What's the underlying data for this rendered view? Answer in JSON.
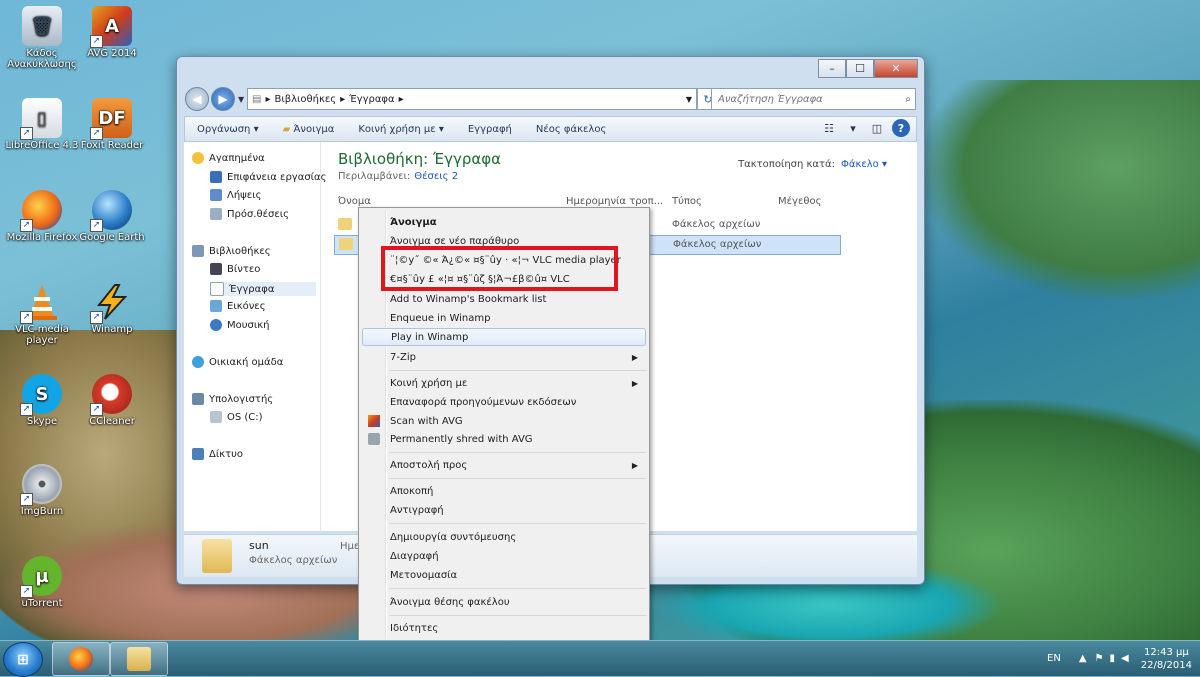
{
  "desktop": {
    "icons": [
      {
        "label": "Κάδος Ανακύκλωσης"
      },
      {
        "label": "AVG 2014"
      },
      {
        "label": "LibreOffice 4.3"
      },
      {
        "label": "Foxit Reader"
      },
      {
        "label": "Mozilla Firefox"
      },
      {
        "label": "Google Earth"
      },
      {
        "label": "VLC media player"
      },
      {
        "label": "Winamp"
      },
      {
        "label": "Skype"
      },
      {
        "label": "CCleaner"
      },
      {
        "label": "ImgBurn"
      },
      {
        "label": "uTorrent"
      }
    ]
  },
  "window": {
    "address": {
      "segments": [
        "Βιβλιοθήκες",
        "Έγγραφα"
      ]
    },
    "search": {
      "placeholder": "Αναζήτηση Έγγραφα"
    },
    "toolbar": {
      "organize": "Οργάνωση",
      "open": "Άνοιγμα",
      "share": "Κοινή χρήση με",
      "burn": "Εγγραφή",
      "new_folder": "Νέος φάκελος"
    },
    "nav": {
      "favorites": "Αγαπημένα",
      "desktop": "Επιφάνεια εργασίας",
      "downloads": "Λήψεις",
      "recent": "Πρόσ.θέσεις",
      "libraries": "Βιβλιοθήκες",
      "videos": "Βίντεο",
      "documents": "Έγγραφα",
      "pictures": "Εικόνες",
      "music": "Μουσική",
      "homegroup": "Οικιακή ομάδα",
      "computer": "Υπολογιστής",
      "os_drive": "OS (C:)",
      "network": "Δίκτυο"
    },
    "library": {
      "title": "Βιβλιοθήκη: Έγγραφα",
      "includes_label": "Περιλαμβάνει:",
      "locations": "Θέσεις 2",
      "arrange_label": "Τακτοποίηση κατά:",
      "arrange_value": "Φάκελο"
    },
    "columns": {
      "name": "Όνομα",
      "date": "Ημερομηνία τροπ...",
      "type": "Τύπος",
      "size": "Μέγεθος"
    },
    "rows": [
      {
        "type": "Φάκελος αρχείων"
      },
      {
        "type": "Φάκελος αρχείων"
      }
    ],
    "details": {
      "name": "sun",
      "kind": "Φάκελος αρχείων",
      "date_prefix": "Ημε"
    }
  },
  "context_menu": {
    "items": [
      "Άνοιγμα",
      "Άνοιγμα σε νέο παράθυρο",
      "¨¦©у˝ ©« Ά¿©« ¤§¨ûу ·  «¦¬ VLC media player",
      "€¤§¨ûу £ «¦¤ ¤§¨ûζ §¦Ά¬£β©û¤ VLC",
      "Add to Winamp's Bookmark list",
      "Enqueue in Winamp",
      "Play in Winamp",
      "7-Zip",
      "Κοινή χρήση με",
      "Επαναφορά προηγούμενων εκδόσεων",
      "Scan with AVG",
      "Permanently shred with AVG",
      "Αποστολή προς",
      "Αποκοπή",
      "Αντιγραφή",
      "Δημιουργία συντόμευσης",
      "Διαγραφή",
      "Μετονομασία",
      "Άνοιγμα θέσης φακέλου",
      "Ιδιότητες"
    ]
  },
  "taskbar": {
    "language": "EN",
    "time": "12:43 μμ",
    "date": "22/8/2014"
  },
  "colors": {
    "highlight_box": "#e0161c",
    "library_title": "#1e6b33",
    "link": "#1a55c7"
  }
}
